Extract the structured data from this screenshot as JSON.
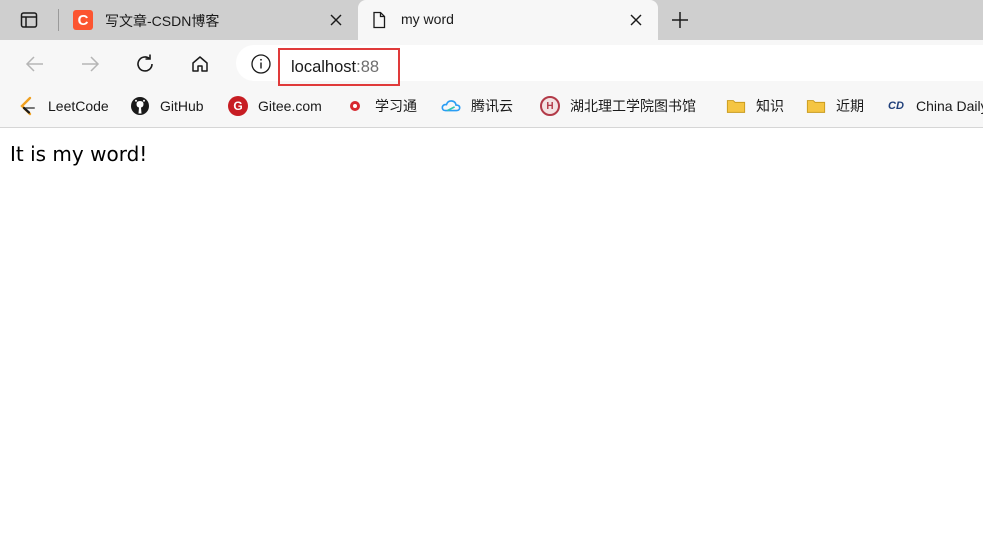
{
  "tabs": [
    {
      "title": "写文章-CSDN博客",
      "favicon": "csdn-logo-icon",
      "favicon_text": "C",
      "active": false
    },
    {
      "title": "my word",
      "favicon": "page-icon",
      "active": true
    }
  ],
  "toolbar": {
    "url_host": "localhost",
    "url_port": ":88"
  },
  "bookmarks": [
    {
      "label": "LeetCode",
      "icon": "leetcode-icon"
    },
    {
      "label": "GitHub",
      "icon": "github-icon"
    },
    {
      "label": "Gitee.com",
      "icon": "gitee-icon",
      "icon_text": "G"
    },
    {
      "label": "学习通",
      "icon": "xuexitong-icon"
    },
    {
      "label": "腾讯云",
      "icon": "tencent-cloud-icon"
    },
    {
      "label": "湖北理工学院图书馆",
      "icon": "library-icon",
      "icon_text": "H"
    },
    {
      "label": "知识",
      "icon": "folder-icon"
    },
    {
      "label": "近期",
      "icon": "folder-icon"
    },
    {
      "label": "China Daily",
      "icon": "chinadaily-icon",
      "icon_text": "CD"
    }
  ],
  "page": {
    "content": "It is my word!"
  },
  "colors": {
    "highlight": "#e03a3a",
    "csdn": "#fc5531",
    "gitee": "#c71d23",
    "folder": "#f5c542"
  }
}
